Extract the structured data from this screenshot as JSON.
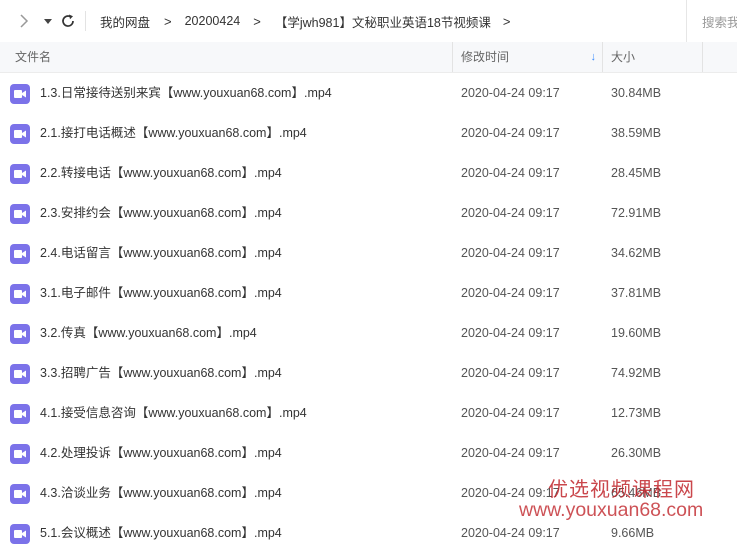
{
  "toolbar": {
    "breadcrumbs": [
      "我的网盘",
      "20200424",
      "【学jwh981】文秘职业英语18节视频课"
    ],
    "search_placeholder": "搜索我",
    "forward_icon": "chevron-right-icon",
    "dropdown_icon": "caret-down-icon",
    "refresh_icon": "refresh-icon"
  },
  "header": {
    "name": "文件名",
    "modified": "修改时间",
    "size": "大小",
    "sort_indicator": "↓"
  },
  "files": [
    {
      "name": "1.3.日常接待送别来宾【www.youxuan68.com】.mp4",
      "modified": "2020-04-24 09:17",
      "size": "30.84MB"
    },
    {
      "name": "2.1.接打电话概述【www.youxuan68.com】.mp4",
      "modified": "2020-04-24 09:17",
      "size": "38.59MB"
    },
    {
      "name": "2.2.转接电话【www.youxuan68.com】.mp4",
      "modified": "2020-04-24 09:17",
      "size": "28.45MB"
    },
    {
      "name": "2.3.安排约会【www.youxuan68.com】.mp4",
      "modified": "2020-04-24 09:17",
      "size": "72.91MB"
    },
    {
      "name": "2.4.电话留言【www.youxuan68.com】.mp4",
      "modified": "2020-04-24 09:17",
      "size": "34.62MB"
    },
    {
      "name": "3.1.电子邮件【www.youxuan68.com】.mp4",
      "modified": "2020-04-24 09:17",
      "size": "37.81MB"
    },
    {
      "name": "3.2.传真【www.youxuan68.com】.mp4",
      "modified": "2020-04-24 09:17",
      "size": "19.60MB"
    },
    {
      "name": "3.3.招聘广告【www.youxuan68.com】.mp4",
      "modified": "2020-04-24 09:17",
      "size": "74.92MB"
    },
    {
      "name": "4.1.接受信息咨询【www.youxuan68.com】.mp4",
      "modified": "2020-04-24 09:17",
      "size": "12.73MB"
    },
    {
      "name": "4.2.处理投诉【www.youxuan68.com】.mp4",
      "modified": "2020-04-24 09:17",
      "size": "26.30MB"
    },
    {
      "name": "4.3.洽谈业务【www.youxuan68.com】.mp4",
      "modified": "2020-04-24 09:17",
      "size": "65.46MB"
    },
    {
      "name": "5.1.会议概述【www.youxuan68.com】.mp4",
      "modified": "2020-04-24 09:17",
      "size": "9.66MB"
    }
  ],
  "file_icon": "video-file-icon",
  "colors": {
    "video_icon": "#7b72e9",
    "sort_accent": "#3b8cff",
    "watermark": "#c1272d"
  },
  "watermark": {
    "line1": "优选视频课程网",
    "line2": "www.youxuan68.com"
  }
}
